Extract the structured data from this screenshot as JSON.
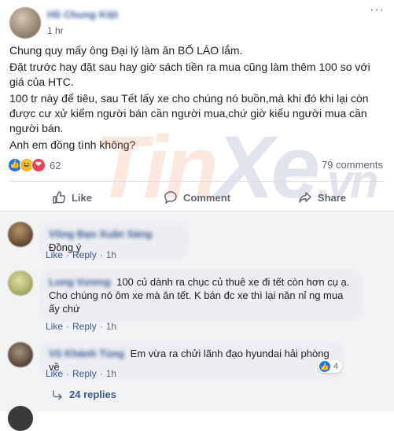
{
  "post": {
    "author": "Hồ Chung Kiệt",
    "time": "1 hr",
    "menu": "···",
    "paragraphs": [
      "Chung quy mấy ông Đại lý làm ăn BỐ LÁO lắm.",
      "Đặt trước hay đặt sau hay giờ sách tiền ra mua cũng làm thêm 100 so với giá của HTC.",
      "100 tr này để tiêu, sau Tết lấy xe cho chúng nó buồn,mà khi đó khi lại còn được cư xử kiểm người bán cần người mua,chứ giờ kiểu người mua cần người bán.",
      "Anh em đồng tình không?"
    ],
    "reaction_count": "62",
    "comment_count": "79 comments",
    "actions": {
      "like": "Like",
      "comment": "Comment",
      "share": "Share"
    },
    "watermark": {
      "prefix": "Tin",
      "main": "Xe",
      "suffix": ".vn"
    }
  },
  "comments": [
    {
      "author": "Vũng Đạo Xuân Sáng",
      "text": "Đồng ý",
      "like": "Like",
      "reply": "Reply",
      "time": "1h"
    },
    {
      "author": "Long Vương",
      "text": "100 củ dành ra chục củ thuê xe đi tết còn hơn cụ ạ. Cho chúng nó ôm xe mà ăn tết. K bán đc xe thì lại năn nỉ ng mua ấy chứ",
      "like": "Like",
      "reply": "Reply",
      "time": "1h"
    },
    {
      "author": "Vũ Khánh Tùng",
      "text": "Em vừa ra chửi lãnh đạo hyundai hải phòng về",
      "like": "Like",
      "reply": "Reply",
      "time": "1h",
      "like_badge": "4"
    }
  ],
  "replies_label": "24 replies",
  "colors": {
    "link": "#385898",
    "like_blue": "#1877f2",
    "secondary": "#606770"
  }
}
